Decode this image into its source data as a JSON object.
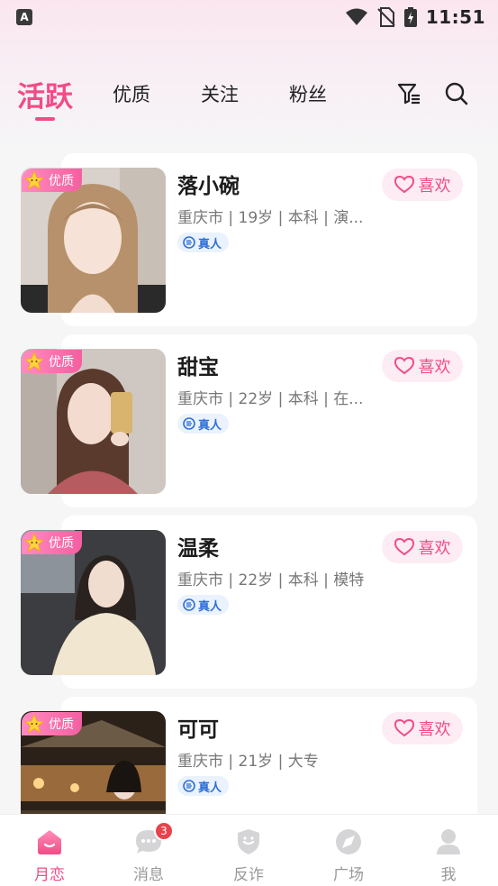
{
  "status_bar": {
    "time": "11:51",
    "app_icon_letter": "A"
  },
  "tabs": [
    {
      "label": "活跃",
      "active": true
    },
    {
      "label": "优质",
      "active": false
    },
    {
      "label": "关注",
      "active": false
    },
    {
      "label": "粉丝",
      "active": false
    }
  ],
  "header_icons": [
    "filter-icon",
    "search-icon"
  ],
  "cards": [
    {
      "badge": "优质",
      "name": "落小碗",
      "meta": "重庆市 | 19岁 | 本科 | 演...",
      "verified": "真人",
      "like_label": "喜欢"
    },
    {
      "badge": "优质",
      "name": "甜宝",
      "meta": "重庆市 | 22岁 | 本科 | 在...",
      "verified": "真人",
      "like_label": "喜欢"
    },
    {
      "badge": "优质",
      "name": "温柔",
      "meta": "重庆市 | 22岁 | 本科 | 模特",
      "verified": "真人",
      "like_label": "喜欢"
    },
    {
      "badge": "优质",
      "name": "可可",
      "meta": "重庆市 | 21岁 | 大专",
      "verified": "真人",
      "like_label": "喜欢"
    }
  ],
  "bottom_nav": [
    {
      "label": "月恋",
      "icon": "home-icon",
      "active": true
    },
    {
      "label": "消息",
      "icon": "chat-icon",
      "active": false,
      "badge": "3"
    },
    {
      "label": "反诈",
      "icon": "shield-icon",
      "active": false
    },
    {
      "label": "广场",
      "icon": "compass-icon",
      "active": false
    },
    {
      "label": "我",
      "icon": "user-icon",
      "active": false
    }
  ],
  "colors": {
    "accent": "#f04c88",
    "verified": "#2d6fd6",
    "badge_red": "#e8434b"
  }
}
